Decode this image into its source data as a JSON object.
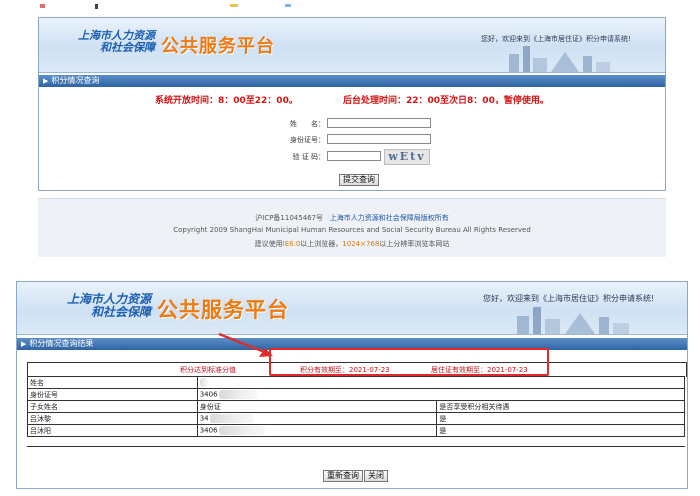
{
  "top": {
    "header": {
      "org_line1": "上海市人力资源",
      "org_line2": "和社会保障",
      "platform": "公共服务平台",
      "welcome": "您好，欢迎来到《上海市居住证》积分申请系统!"
    },
    "section_title": "积分情况查询",
    "notice_open": "系统开放时间：8：00至22：00。",
    "notice_backend": "后台处理时间：22：00至次日8：00，暂停使用。",
    "form": {
      "name_label": "姓　　名：",
      "id_label": "身份证号：",
      "captcha_label": "验 证 码：",
      "name_value": "",
      "id_value": "",
      "captcha_value": "",
      "captcha_image": "wEtv",
      "submit_label": "提交查询"
    },
    "footer": {
      "icp": "沪ICP备11045467号",
      "owner": "上海市人力资源和社会保障局版权所有",
      "copyright": "Copyright 2009 ShangHai Municipal Human Resources and Social Security Bureau All Rights Reserved",
      "browser_prefix": "建议使用",
      "browser_ie": "IE6.0",
      "browser_mid": "以上浏览器，",
      "browser_res": "1024×768",
      "browser_suffix": "以上分辨率浏览本网站"
    }
  },
  "bottom": {
    "header": {
      "org_line1": "上海市人力资源",
      "org_line2": "和社会保障",
      "platform": "公共服务平台",
      "welcome": "您好，欢迎来到《上海市居住证》积分申请系统!"
    },
    "section_title": "积分情况查询结果",
    "summary": {
      "standard": "积分达到标准分值",
      "points_valid": "积分有效期至：2021-07-23",
      "permit_valid": "居住证有效期至：2021-07-23"
    },
    "table": {
      "name_label": "姓名",
      "id_label": "身份证号",
      "id_value": "3406",
      "child_name_header": "子女姓名",
      "child_id_header": "身份证",
      "benefit_header": "是否享受积分相关待遇",
      "children": [
        {
          "name": "吕沐黎",
          "id": "34",
          "benefit": "是"
        },
        {
          "name": "吕沐阳",
          "id": "3406",
          "benefit": "是"
        }
      ]
    },
    "requery_label": "重新查询",
    "close_label": "关闭"
  },
  "colors": {
    "accent_red": "#d31313",
    "org_blue": "#1d5fb1",
    "platform_orange": "#f07a12",
    "bar_blue": "#2f63a3"
  }
}
